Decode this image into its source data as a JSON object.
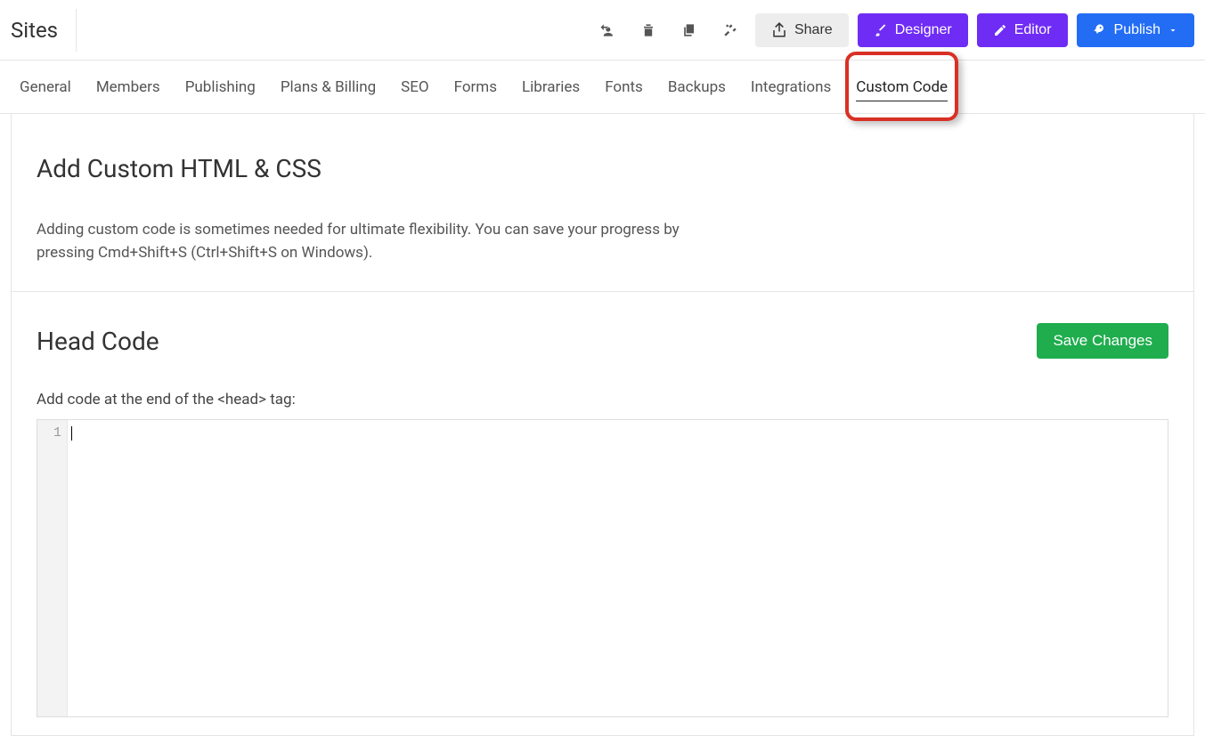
{
  "header": {
    "title": "Sites",
    "share_label": "Share",
    "designer_label": "Designer",
    "editor_label": "Editor",
    "publish_label": "Publish"
  },
  "tabs": {
    "general": "General",
    "members": "Members",
    "publishing": "Publishing",
    "plans": "Plans & Billing",
    "seo": "SEO",
    "forms": "Forms",
    "libraries": "Libraries",
    "fonts": "Fonts",
    "backups": "Backups",
    "integrations": "Integrations",
    "custom_code": "Custom Code"
  },
  "main": {
    "title": "Add Custom HTML & CSS",
    "description": "Adding custom code is sometimes needed for ultimate flexibility. You can save your progress by pressing Cmd+Shift+S (Ctrl+Shift+S on Windows)."
  },
  "head": {
    "title": "Head Code",
    "save_label": "Save Changes",
    "label": "Add code at the end of the <head> tag:",
    "line_number": "1",
    "code_value": ""
  }
}
